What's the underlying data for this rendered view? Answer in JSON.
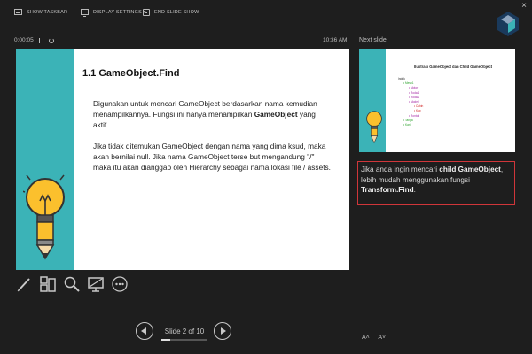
{
  "toolbar": {
    "show_taskbar": "SHOW TASKBAR",
    "display_settings": "DISPLAY SETTINGS ▾",
    "end_slide_show": "END SLIDE SHOW",
    "close": "×"
  },
  "timer": {
    "elapsed": "0:00:05"
  },
  "clock": "10:36 AM",
  "next_slide_label": "Next slide",
  "current_slide": {
    "title": "1.1 GameObject.Find",
    "para1_pre": "Digunakan untuk mencari GameObject berdasarkan nama kemudian menampilkannya. Fungsi ini hanya menampilkan ",
    "para1_bold": "GameObject",
    "para1_post": " yang aktif.",
    "para2": "Jika tidak ditemukan GameObject dengan nama yang dima ksud, maka akan bernilai null. Jika nama GameObject terse but mengandung \"/\" maka itu akan dianggap oleh Hierarchy sebagai nama lokasi file / assets."
  },
  "nav": {
    "slide_count": "Slide 2 of 10",
    "progress": 0.2
  },
  "next_slide": {
    "title": "Ilustrasi GameObject dan Child GameObject",
    "tree": [
      {
        "label": "Induk",
        "color": "#222222",
        "level": 0
      },
      {
        "label": "Mesh1",
        "color": "#2aa12a",
        "level": 1
      },
      {
        "label": "Motor",
        "color": "#a020a0",
        "level": 2
      },
      {
        "label": "Roda1",
        "color": "#a020a0",
        "level": 2
      },
      {
        "label": "Roda2",
        "color": "#a020a0",
        "level": 2
      },
      {
        "label": "Model",
        "color": "#a020a0",
        "level": 2
      },
      {
        "label": "Cabin",
        "color": "#d02020",
        "level": 3
      },
      {
        "label": "Kap",
        "color": "#d02020",
        "level": 3
      },
      {
        "label": "Rontok",
        "color": "#a020a0",
        "level": 2
      },
      {
        "label": "Tanpa",
        "color": "#2aa12a",
        "level": 1
      },
      {
        "label": "Kari",
        "color": "#2aa12a",
        "level": 1
      }
    ]
  },
  "notes": {
    "pre": "Jika anda ingin mencari ",
    "bold1": "child GameObject",
    "mid": ", lebih mudah menggunakan fungsi ",
    "bold2": "Transform.Find",
    "post": "."
  },
  "font_buttons": {
    "larger": "A˄",
    "smaller": "A˅"
  },
  "icons": [
    "pen-icon",
    "slide-grid-icon",
    "zoom-icon",
    "screen-icon",
    "more-options-icon"
  ]
}
